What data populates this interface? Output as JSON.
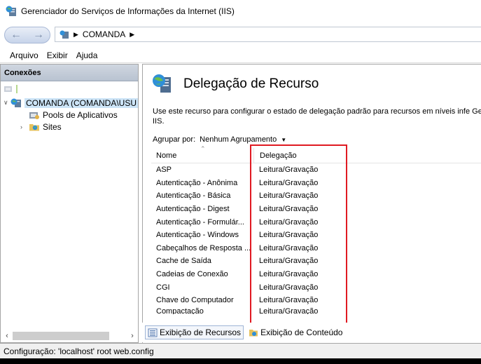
{
  "window": {
    "title": "Gerenciador do Serviços de Informações da Internet (IIS)"
  },
  "address_bar": {
    "crumbs": [
      "COMANDA"
    ]
  },
  "menu": {
    "items": [
      "Arquivo",
      "Exibir",
      "Ajuda"
    ]
  },
  "connections": {
    "header": "Conexões",
    "tree": {
      "root": "COMANDA (COMANDA\\USU",
      "children": [
        "Pools de Aplicativos",
        "Sites"
      ]
    }
  },
  "feature": {
    "title": "Delegação de Recurso",
    "description": "Use este recurso para configurar o estado de delegação padrão para recursos em níveis infe Gerenciador do IIS.",
    "group_by_label": "Agrupar por:",
    "group_by_value": "Nenhum Agrupamento"
  },
  "grid": {
    "columns": [
      "Nome",
      "Delegação"
    ],
    "rows": [
      {
        "name": "ASP",
        "delegation": "Leitura/Gravação"
      },
      {
        "name": "Autenticação - Anônima",
        "delegation": "Leitura/Gravação"
      },
      {
        "name": "Autenticação - Básica",
        "delegation": "Leitura/Gravação"
      },
      {
        "name": "Autenticação - Digest",
        "delegation": "Leitura/Gravação"
      },
      {
        "name": "Autenticação - Formulár...",
        "delegation": "Leitura/Gravação"
      },
      {
        "name": "Autenticação - Windows",
        "delegation": "Leitura/Gravação"
      },
      {
        "name": "Cabeçalhos de Resposta ...",
        "delegation": "Leitura/Gravação"
      },
      {
        "name": "Cache de Saída",
        "delegation": "Leitura/Gravação"
      },
      {
        "name": "Cadeias de Conexão",
        "delegation": "Leitura/Gravação"
      },
      {
        "name": "CGI",
        "delegation": "Leitura/Gravação"
      },
      {
        "name": "Chave do Computador",
        "delegation": "Leitura/Gravação"
      },
      {
        "name": "Compactação",
        "delegation": "Leitura/Gravação"
      }
    ]
  },
  "view_tabs": {
    "features": "Exibição de Recursos",
    "content": "Exibição de Conteúdo"
  },
  "status": {
    "text": "Configuração: 'localhost' root web.config"
  },
  "colors": {
    "highlight": "#e01a22",
    "selection": "#cce4f7",
    "pane_header": "#b9c3d1"
  }
}
